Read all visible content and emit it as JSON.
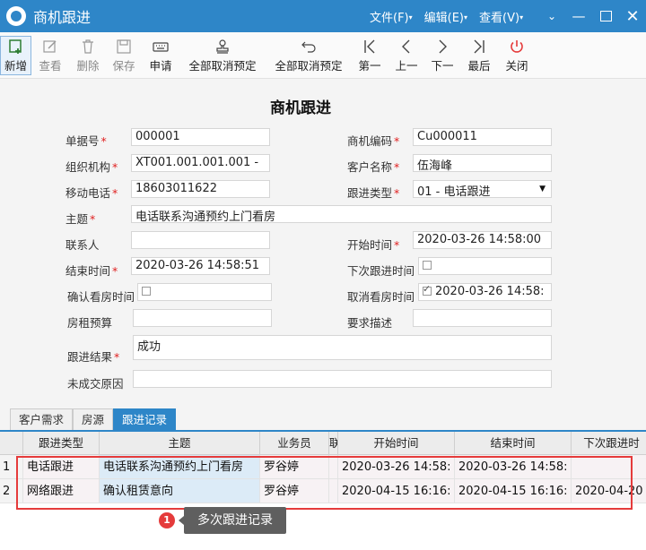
{
  "window": {
    "title": "商机跟进",
    "menus": [
      {
        "label": "文件(F)"
      },
      {
        "label": "编辑(E)"
      },
      {
        "label": "查看(V)"
      }
    ]
  },
  "toolbar": {
    "new": "新增",
    "view": "查看",
    "delete": "删除",
    "save": "保存",
    "apply": "申请",
    "cancel_all_1": "全部取消预定",
    "cancel_all_2": "全部取消预定",
    "first": "第一",
    "prev": "上一",
    "next": "下一",
    "last": "最后",
    "close": "关闭"
  },
  "form": {
    "title": "商机跟进",
    "doc_no_label": "单据号",
    "doc_no": "000001",
    "opp_code_label": "商机编码",
    "opp_code": "Cu000011",
    "org_label": "组织机构",
    "org": "XT001.001.001.001 -",
    "customer_label": "客户名称",
    "customer": "伍海峰",
    "mobile_label": "移动电话",
    "mobile": "18603011622",
    "follow_type_label": "跟进类型",
    "follow_type": "01 - 电话跟进",
    "subject_label": "主题",
    "subject": "电话联系沟通预约上门看房",
    "contact_label": "联系人",
    "contact": "",
    "start_label": "开始时间",
    "start": "2020-03-26 14:58:00",
    "end_label": "结束时间",
    "end": "2020-03-26 14:58:51",
    "next_follow_label": "下次跟进时间",
    "confirm_view_label": "确认看房时间",
    "cancel_view_label": "取消看房时间",
    "cancel_view": "2020-03-26 14:58:",
    "budget_label": "房租预算",
    "requirement_label": "要求描述",
    "result_label": "跟进结果",
    "result": "成功",
    "fail_reason_label": "未成交原因"
  },
  "tabs": [
    "客户需求",
    "房源",
    "跟进记录"
  ],
  "grid": {
    "headers": [
      "跟进类型",
      "主题",
      "业务员",
      "联",
      "开始时间",
      "结束时间",
      "下次跟进时"
    ],
    "rows": [
      {
        "n": "1",
        "type": "电话跟进",
        "subject": "电话联系沟通预约上门看房",
        "staff": "罗谷婷",
        "start": "2020-03-26 14:58:",
        "end": "2020-03-26 14:58:",
        "next": ""
      },
      {
        "n": "2",
        "type": "网络跟进",
        "subject": "确认租赁意向",
        "staff": "罗谷婷",
        "start": "2020-04-15 16:16:",
        "end": "2020-04-15 16:16:",
        "next": "2020-04-20"
      }
    ]
  },
  "callout": {
    "number": "1",
    "text": "多次跟进记录"
  }
}
